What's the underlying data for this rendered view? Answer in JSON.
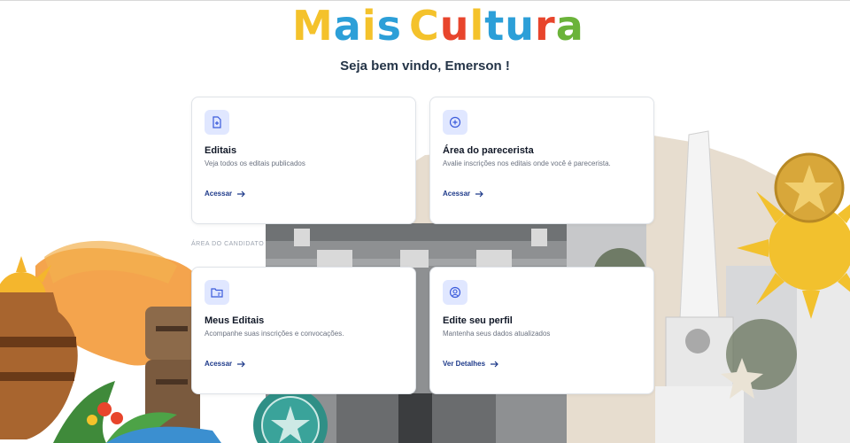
{
  "logo": {
    "letters": [
      {
        "ch": "M",
        "color": "#f4c22b"
      },
      {
        "ch": "a",
        "color": "#2c9fd8"
      },
      {
        "ch": "i",
        "color": "#f4c22b"
      },
      {
        "ch": "s",
        "color": "#2c9fd8"
      },
      {
        "ch": " ",
        "color": "#ffffff"
      },
      {
        "ch": "C",
        "color": "#f4c22b"
      },
      {
        "ch": "u",
        "color": "#e8452c"
      },
      {
        "ch": "l",
        "color": "#f4c22b"
      },
      {
        "ch": "t",
        "color": "#2c9fd8"
      },
      {
        "ch": "u",
        "color": "#2c9fd8"
      },
      {
        "ch": "r",
        "color": "#e8452c"
      },
      {
        "ch": "a",
        "color": "#6bb33a"
      }
    ]
  },
  "welcome": "Seja bem vindo, Emerson !",
  "section_label": "ÁREA DO CANDIDATO",
  "cards": [
    {
      "title": "Editais",
      "desc": "Veja todos os editais publicados",
      "link": "Acessar",
      "icon": "document-icon"
    },
    {
      "title": "Área do parecerista",
      "desc": "Avalie inscrições nos editais onde você é parecerista.",
      "link": "Acessar",
      "icon": "plus-circle-icon"
    },
    {
      "title": "Meus Editais",
      "desc": "Acompanhe suas inscrições e convocações.",
      "link": "Acessar",
      "icon": "folder-icon"
    },
    {
      "title": "Edite seu perfil",
      "desc": "Mantenha seus dados atualizados",
      "link": "Ver Detalhes",
      "icon": "profile-gear-icon"
    }
  ],
  "colors": {
    "accent": "#1e3a8a",
    "icon_bg": "#e0e7ff"
  }
}
